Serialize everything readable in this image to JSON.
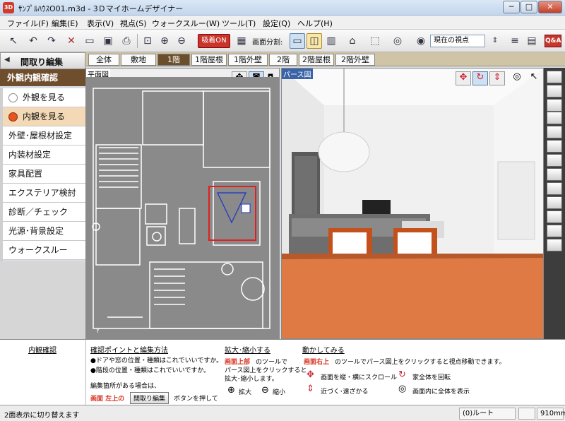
{
  "titlebar": {
    "icon": "3D",
    "title": "ｻﾝﾌﾟﾙﾊｳｽO01.m3d - 3Ｄマイホームデザイナー",
    "minimize": "─",
    "maximize": "□",
    "close": "✕"
  },
  "menu": [
    {
      "label": "ファイル(F)"
    },
    {
      "label": "編集(E)"
    },
    {
      "label": "表示(V)"
    },
    {
      "label": "視点(S)"
    },
    {
      "label": "ウォークスルー(W)"
    },
    {
      "label": "ツール(T)"
    },
    {
      "label": "設定(Q)"
    },
    {
      "label": "ヘルプ(H)"
    }
  ],
  "toolbar": {
    "kyuchaku": "吸着ON",
    "split_label": "画面分割:",
    "view_select": "現在の視点",
    "qa": "Q&A"
  },
  "left": {
    "head": "間取り編集",
    "head_arrow": "◀",
    "section": "外観内観確認",
    "radios": [
      {
        "label": "外観を見る",
        "selected": false
      },
      {
        "label": "内観を見る",
        "selected": true
      }
    ],
    "items": [
      {
        "label": "外壁･屋根材設定"
      },
      {
        "label": "内装材設定"
      },
      {
        "label": "家具配置"
      },
      {
        "label": "エクステリア検討"
      },
      {
        "label": "診断／チェック"
      },
      {
        "label": "光源･背景設定"
      },
      {
        "label": "ウォークスルー"
      }
    ]
  },
  "floortabs": [
    {
      "label": "全体",
      "active": false
    },
    {
      "label": "敷地",
      "active": false
    },
    {
      "label": "1階",
      "active": true
    },
    {
      "label": "1階屋根",
      "active": false
    },
    {
      "label": "1階外壁",
      "active": false
    },
    {
      "label": "2階",
      "active": false
    },
    {
      "label": "2階屋根",
      "active": false
    },
    {
      "label": "2階外壁",
      "active": false
    }
  ],
  "plan": {
    "label": "平面図"
  },
  "persp": {
    "label": "パース図"
  },
  "help": {
    "col1_title": "内観確認",
    "col2_title": "確認ポイントと編集方法",
    "col2_line1": "●ドアや窓の位置・種類はこれでいいですか。",
    "col2_line2": "●階段の位置・種類はこれでいいですか。",
    "col2_line3": "編集箇所がある場合は、",
    "col2_line4_red": "画面 左上の",
    "col2_btn": "間取り編集",
    "col2_line4_rest": "ボタンを押して",
    "col3_title": "拡大･縮小する",
    "col3_red": "画面上部",
    "col3_line1": "のツールで",
    "col3_line2": "パース図上をクリックすると",
    "col3_line3": "拡大･縮小します。",
    "col3_zoomin": "拡大",
    "col3_zoomout": "縮小",
    "col4_title": "動かしてみる",
    "col4_red": "画面右上",
    "col4_line1": "のツールでパース図上をクリックすると視点移動できます。",
    "col4_a": "画面を縦・横にスクロール",
    "col4_b": "近づく･遠ざかる",
    "col4_c": "家全体を回転",
    "col4_d": "画面内に全体を表示"
  },
  "status": {
    "left": "2面表示に切り替えます",
    "route": "(0)ルート",
    "value": "910mm"
  },
  "colors": {
    "accent": "#6b4f2c",
    "red": "#c8352b",
    "selected_radio": "#e8551e"
  }
}
